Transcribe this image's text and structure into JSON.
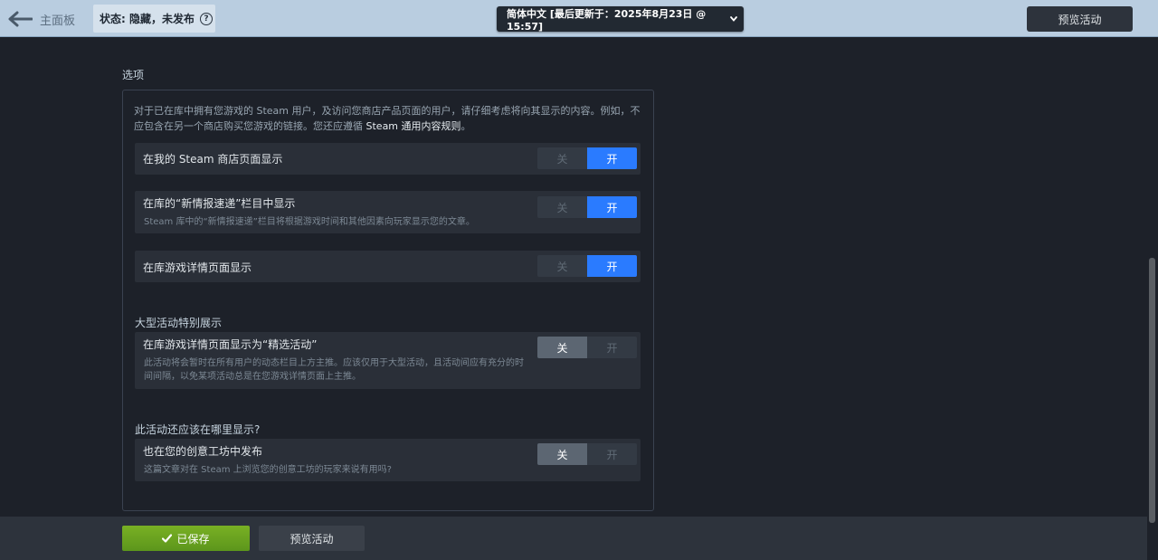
{
  "topbar": {
    "back_label": "主面板",
    "status_label": "状态: 隐藏，未发布",
    "language_select": "简体中文 [最后更新于：2025年8月23日 @ 15:57]",
    "preview_label": "预览活动"
  },
  "options": {
    "section_title": "选项",
    "intro_part1": "对于已在库中拥有您游戏的 Steam 用户，及访问您商店产品页面的用户，请仔细考虑将向其显示的内容。例如，不应包含在另一个商店购买您游戏的链接。您还应遵循 ",
    "intro_link": "Steam 通用内容规则",
    "intro_part2": "。",
    "toggle_off": "关",
    "toggle_on": "开",
    "rows": [
      {
        "title": "在我的 Steam 商店页面显示",
        "desc": "",
        "state": "开"
      },
      {
        "title": "在库的“新情报速递”栏目中显示",
        "desc": "Steam 库中的“新情报速递”栏目将根据游戏时间和其他因素向玩家显示您的文章。",
        "state": "开"
      },
      {
        "title": "在库游戏详情页面显示",
        "desc": "",
        "state": "开"
      },
      {
        "title": "在库游戏详情页面显示为“精选活动”",
        "desc": "此活动将会暂时在所有用户的动态栏目上方主推。应该仅用于大型活动，且活动间应有充分的时间间隔，以免某项活动总是在您游戏详情页面上主推。",
        "state": "关"
      },
      {
        "title": "也在您的创意工坊中发布",
        "desc": "这篇文章对在 Steam 上浏览您的创意工坊的玩家来说有用吗?",
        "state": "关"
      }
    ],
    "subhead_major": "大型活动特别展示",
    "subhead_where": "此活动还应该在哪里显示?"
  },
  "bottombar": {
    "saved_label": "已保存",
    "preview_label": "预览活动"
  },
  "colors": {
    "accent_blue": "#2a7bff",
    "saved_green": "#6ba323",
    "topbar_bg": "#b9cde0"
  }
}
